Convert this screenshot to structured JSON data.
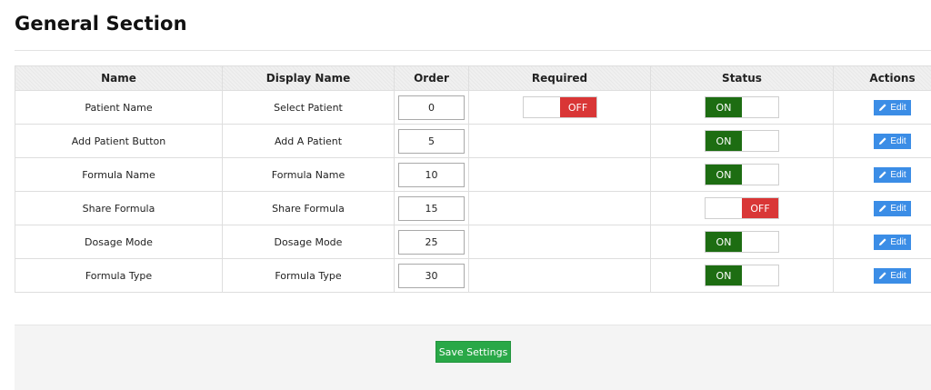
{
  "page": {
    "title": "General Section"
  },
  "table": {
    "headers": {
      "name": "Name",
      "display_name": "Display Name",
      "order": "Order",
      "required": "Required",
      "status": "Status",
      "actions": "Actions"
    },
    "rows": [
      {
        "name": "Patient Name",
        "display_name": "Select Patient",
        "order": "0",
        "required": "OFF",
        "status": "ON",
        "action": "Edit"
      },
      {
        "name": "Add Patient Button",
        "display_name": "Add A Patient",
        "order": "5",
        "required": "",
        "status": "ON",
        "action": "Edit"
      },
      {
        "name": "Formula Name",
        "display_name": "Formula Name",
        "order": "10",
        "required": "",
        "status": "ON",
        "action": "Edit"
      },
      {
        "name": "Share Formula",
        "display_name": "Share Formula",
        "order": "15",
        "required": "",
        "status": "OFF",
        "action": "Edit"
      },
      {
        "name": "Dosage Mode",
        "display_name": "Dosage Mode",
        "order": "25",
        "required": "",
        "status": "ON",
        "action": "Edit"
      },
      {
        "name": "Formula Type",
        "display_name": "Formula Type",
        "order": "30",
        "required": "",
        "status": "ON",
        "action": "Edit"
      }
    ]
  },
  "footer": {
    "save_label": "Save Settings"
  },
  "colors": {
    "toggle_on": "#1d6d12",
    "toggle_off": "#d93636",
    "edit_button": "#3b8de6",
    "save_button": "#29a847"
  },
  "icons": {
    "edit": "pencil-icon"
  }
}
